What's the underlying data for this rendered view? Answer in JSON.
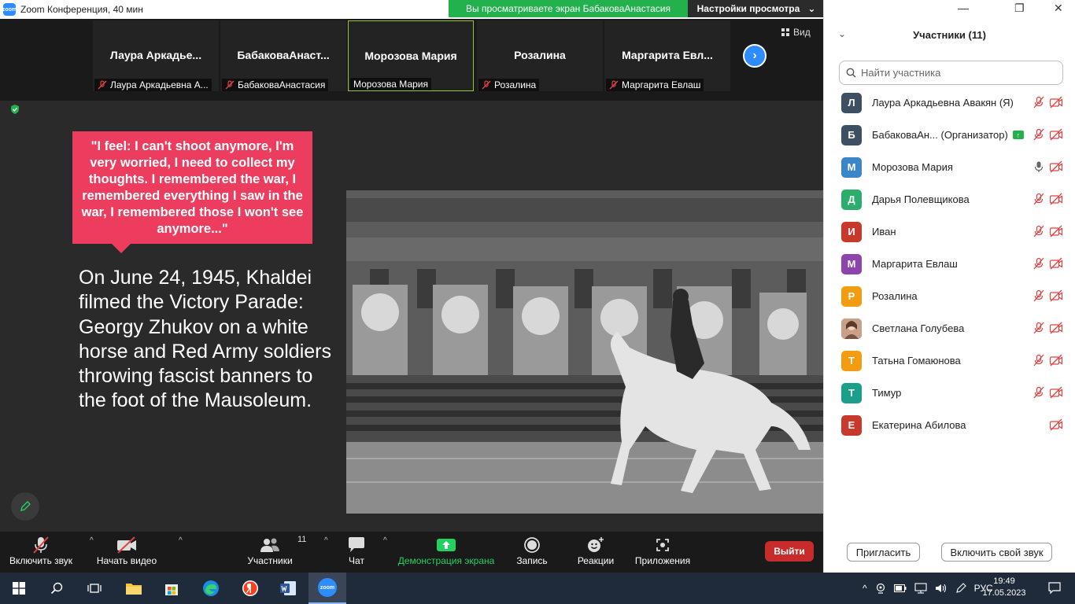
{
  "titlebar": {
    "title": "Zoom Конференция, 40 мин",
    "logo_text": "zoom"
  },
  "share_banner": {
    "text": "Вы просматриваете экран БабаковаАнастасия",
    "view_settings": "Настройки просмотра"
  },
  "strip": {
    "view_label": "Вид",
    "thumbnails": [
      {
        "name": "Лаура Аркадье...",
        "label": "Лаура Аркадьевна А...",
        "muted": true
      },
      {
        "name": "БабаковаАнаст...",
        "label": "БабаковаАнастасия",
        "muted": true
      },
      {
        "name": "Морозова Мария",
        "label": "Морозова Мария",
        "muted": false
      },
      {
        "name": "Розалина",
        "label": "Розалина",
        "muted": true
      },
      {
        "name": "Маргарита Евл...",
        "label": "Маргарита Евлаш",
        "muted": true
      }
    ]
  },
  "slide": {
    "quote": "\"I feel: I can't shoot anymore, I'm very worried, I need to collect my thoughts. I remembered the war, I remembered everything I saw in the war, I remembered those I won't see anymore...\"",
    "body": "On June 24, 1945, Khaldei filmed the Victory Parade: Georgy Zhukov on a white horse and Red Army soldiers throwing fascist banners to the foot of the Mausoleum."
  },
  "toolbar": {
    "unmute": "Включить звук",
    "start_video": "Начать видео",
    "participants": "Участники",
    "participants_count": "11",
    "chat": "Чат",
    "share_screen": "Демонстрация экрана",
    "record": "Запись",
    "reactions": "Реакции",
    "apps": "Приложения",
    "leave": "Выйти"
  },
  "panel": {
    "title": "Участники (11)",
    "search_placeholder": "Найти участника",
    "participants": [
      {
        "initial": "Л",
        "name": "Лаура Аркадьевна Авакян (Я)",
        "color": "#3d4f63",
        "mic": "off",
        "cam": "off"
      },
      {
        "initial": "Б",
        "name": "БабаковаАн...  (Организатор)",
        "color": "#3d4f63",
        "mic": "off",
        "cam": "off",
        "host": true
      },
      {
        "initial": "М",
        "name": "Морозова Мария",
        "color": "#3a86c8",
        "mic": "on",
        "cam": "off"
      },
      {
        "initial": "Д",
        "name": "Дарья Полевщикова",
        "color": "#2bad6c",
        "mic": "off",
        "cam": "off"
      },
      {
        "initial": "И",
        "name": "Иван",
        "color": "#c8392b",
        "mic": "off",
        "cam": "off"
      },
      {
        "initial": "М",
        "name": "Маргарита Евлаш",
        "color": "#8e44ad",
        "mic": "off",
        "cam": "off"
      },
      {
        "initial": "Р",
        "name": "Розалина",
        "color": "#f39c12",
        "mic": "off",
        "cam": "off"
      },
      {
        "initial": "",
        "name": "Светлана Голубева",
        "color": "#b07a6a",
        "mic": "off",
        "cam": "off",
        "photo": true
      },
      {
        "initial": "Т",
        "name": "Татьна Гомаюнова",
        "color": "#f39c12",
        "mic": "off",
        "cam": "off"
      },
      {
        "initial": "Т",
        "name": "Тимур",
        "color": "#1aa08a",
        "mic": "off",
        "cam": "off"
      },
      {
        "initial": "Е",
        "name": "Екатерина Абилова",
        "color": "#c8392b",
        "mic": "none",
        "cam": "off"
      }
    ],
    "invite": "Пригласить",
    "unmute_self": "Включить свой звук"
  },
  "taskbar": {
    "lang": "РУС",
    "time": "19:49",
    "date": "17.05.2023",
    "zoom_icon_text": "zoom"
  }
}
